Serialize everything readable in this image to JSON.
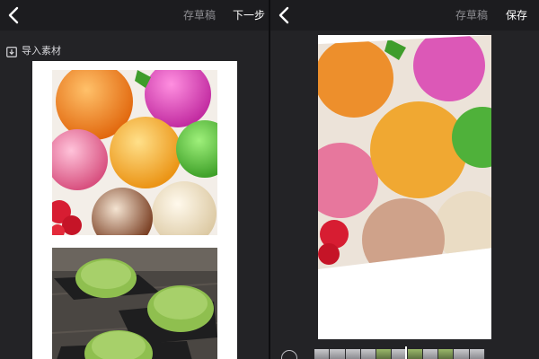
{
  "left_panel": {
    "draft_label": "存草稿",
    "next_label": "下一步",
    "import_label": "导入素材"
  },
  "right_panel": {
    "draft_label": "存草稿",
    "save_label": "保存"
  },
  "colors": {
    "background": "#232326",
    "topbar": "#1c1c1f",
    "muted_text": "#8d8d92",
    "primary_text": "#ffffff",
    "card": "#ffffff"
  },
  "icons": [
    "back-icon",
    "import-icon",
    "timeline-circle-icon"
  ]
}
